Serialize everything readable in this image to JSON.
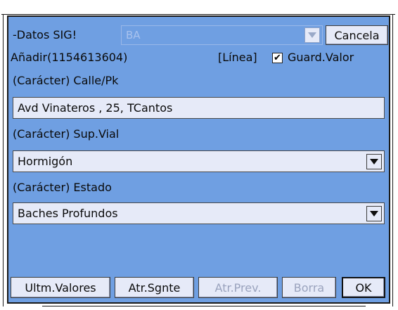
{
  "header": {
    "section_label": "-Datos SIG!",
    "layer_value": "BA",
    "cancel_label": "Cancela"
  },
  "info": {
    "add_label": "Añadir(1154613604)",
    "geometry_type": "[Línea]",
    "save_value_label": "Guard.Valor",
    "save_value_checked": true
  },
  "fields": [
    {
      "label": "(Carácter) Calle/Pk",
      "value": "Avd Vinateros , 25, TCantos"
    },
    {
      "label": "(Carácter) Sup.Vial",
      "value": "Hormigón"
    },
    {
      "label": "(Carácter) Estado",
      "value": "Baches Profundos"
    }
  ],
  "footer": {
    "last_values_label": "Ultm.Valores",
    "next_attr_label": "Atr.Sgnte",
    "prev_attr_label": "Atr.Prev.",
    "delete_label": "Borra",
    "ok_label": "OK"
  },
  "colors": {
    "panel_bg": "#6f9fe2",
    "control_bg": "#e6eaf8",
    "disabled_text": "#9aa3bd"
  }
}
